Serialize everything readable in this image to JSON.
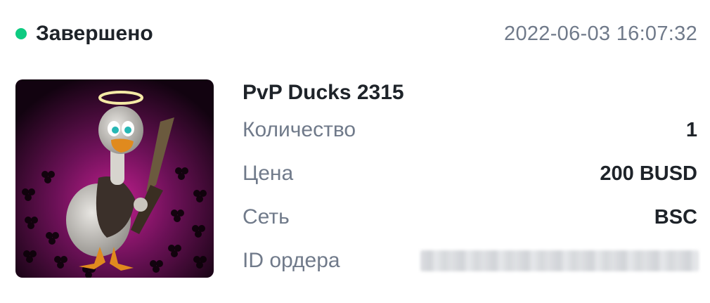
{
  "status": {
    "label": "Завершено",
    "dot_color": "#0ecb81"
  },
  "timestamp": "2022-06-03 16:07:32",
  "nft": {
    "title": "PvP Ducks 2315",
    "image_icon": "duck-nft-image"
  },
  "details": [
    {
      "label": "Количество",
      "value": "1"
    },
    {
      "label": "Цена",
      "value": "200 BUSD"
    },
    {
      "label": "Сеть",
      "value": "BSC"
    },
    {
      "label": "ID ордера",
      "value": ""
    }
  ]
}
